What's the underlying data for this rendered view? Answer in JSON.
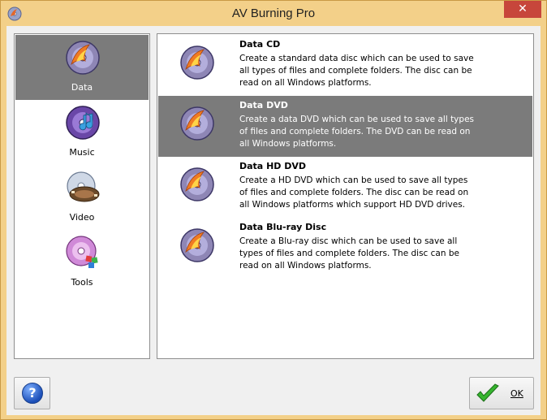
{
  "window": {
    "title": "AV Burning Pro",
    "close_label": "✕"
  },
  "sidebar": {
    "items": [
      {
        "label": "Data",
        "icon": "data-disc-icon",
        "selected": true
      },
      {
        "label": "Music",
        "icon": "music-disc-icon",
        "selected": false
      },
      {
        "label": "Video",
        "icon": "video-disc-icon",
        "selected": false
      },
      {
        "label": "Tools",
        "icon": "tools-disc-icon",
        "selected": false
      }
    ]
  },
  "options": [
    {
      "title": "Data CD",
      "description": "Create a standard data disc which can be used to save all types of files and complete folders. The disc can be read on all Windows platforms.",
      "selected": false
    },
    {
      "title": "Data DVD",
      "description": "Create a data DVD which can be used to save all types of files and complete folders. The DVD can be read on all Windows platforms.",
      "selected": true
    },
    {
      "title": "Data HD DVD",
      "description": "Create a HD DVD which can be used to save all types of files and complete folders. The disc can be read on all Windows platforms which support HD DVD drives.",
      "selected": false
    },
    {
      "title": "Data Blu-ray Disc",
      "description": "Create a Blu-ray disc which can be used to save all types of files and complete folders. The disc can be read on all Windows platforms.",
      "selected": false
    }
  ],
  "footer": {
    "help_label": "?",
    "ok_label": "OK"
  },
  "colors": {
    "frame": "#f3d089",
    "selected_bg": "#7b7b7b",
    "close": "#c7463b"
  }
}
